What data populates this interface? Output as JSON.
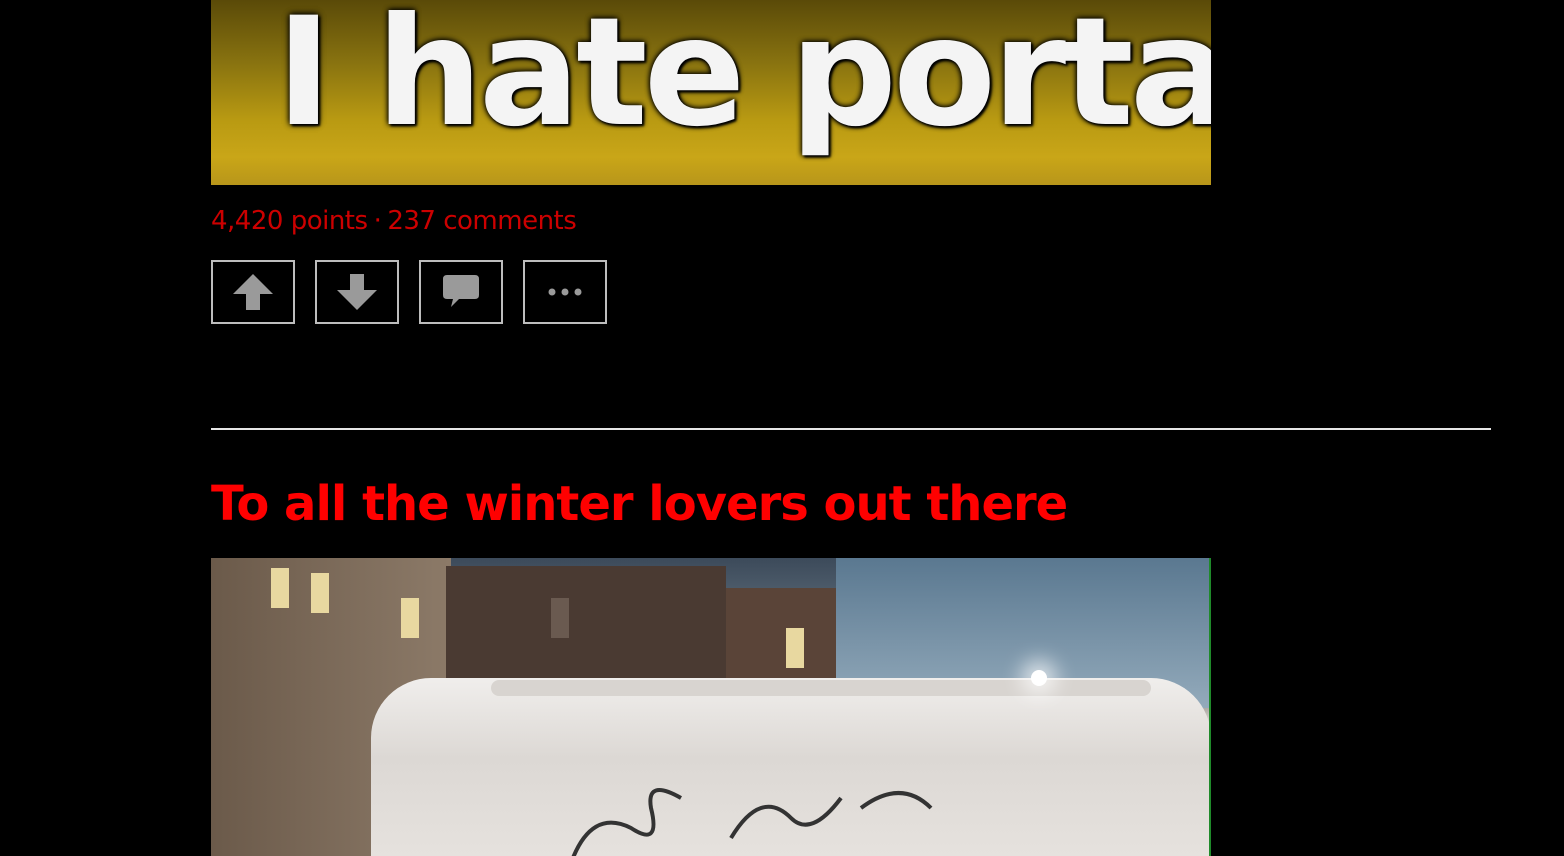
{
  "posts": [
    {
      "image_text": "I hate portals.",
      "points": "4,420 points",
      "separator": "·",
      "comments": "237 comments"
    },
    {
      "title": "To all the winter lovers out there"
    }
  ],
  "actions": {
    "upvote_icon": "arrow-up-icon",
    "downvote_icon": "arrow-down-icon",
    "comment_icon": "speech-bubble-icon",
    "more_icon": "ellipsis-icon"
  },
  "colors": {
    "background": "#000000",
    "accent": "#ff0000",
    "meta_text": "#cc0000",
    "button_border": "#bdbdbd",
    "icon": "#9a9a9a",
    "divider": "#e6e6e6"
  }
}
